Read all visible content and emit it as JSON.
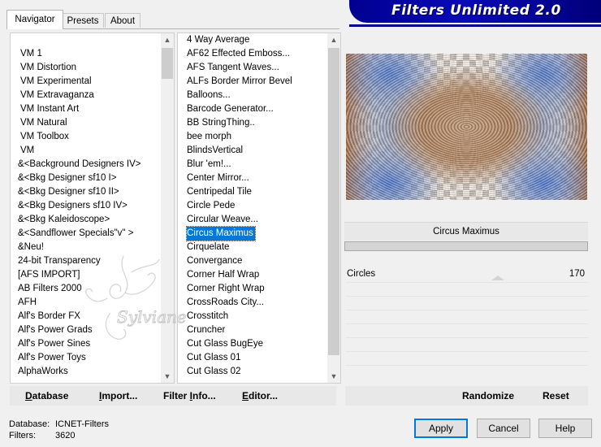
{
  "title": "Filters Unlimited 2.0",
  "tabs": [
    {
      "label": "Navigator",
      "active": true
    },
    {
      "label": "Presets",
      "active": false
    },
    {
      "label": "About",
      "active": false
    }
  ],
  "categories": [
    "VM 1",
    "VM Distortion",
    "VM Experimental",
    "VM Extravaganza",
    "VM Instant Art",
    "VM Natural",
    "VM Toolbox",
    "VM",
    "&<Background Designers IV>",
    "&<Bkg Designer sf10 I>",
    "&<Bkg Designer sf10 II>",
    "&<Bkg Designers sf10 IV>",
    "&<Bkg Kaleidoscope>",
    "&<Sandflower Specials\"v\" >",
    "&Neu!",
    "24-bit Transparency",
    "[AFS IMPORT]",
    "AB Filters 2000",
    "AFH",
    "Alf's Border FX",
    "Alf's Power Grads",
    "Alf's Power Sines",
    "Alf's Power Toys",
    "AlphaWorks"
  ],
  "filters": [
    "4 Way Average",
    "AF62 Effected Emboss...",
    "AFS Tangent Waves...",
    "ALFs Border Mirror Bevel",
    "Balloons...",
    "Barcode Generator...",
    "BB StringThing..",
    "bee morph",
    "BlindsVertical",
    "Blur 'em!...",
    "Center Mirror...",
    "Centripedal Tile",
    "Circle Pede",
    "Circular Weave...",
    "Circus Maximus",
    "Cirquelate",
    "Convergance",
    "Corner Half Wrap",
    "Corner Right Wrap",
    "CrossRoads City...",
    "Crosstitch",
    "Cruncher",
    "Cut Glass  BugEye",
    "Cut Glass 01",
    "Cut Glass 02"
  ],
  "selected_filter": "Circus Maximus",
  "selected_filter_index": 14,
  "parameter": {
    "label": "Circles",
    "value": "170",
    "level": 170,
    "max": 255
  },
  "toolbar": {
    "database": "atabase",
    "database_key": "D",
    "import": "mport...",
    "import_key": "I",
    "filter_info": "Filter ",
    "filter_info_key": "I",
    "filter_info_rest": "nfo...",
    "editor": "ditor...",
    "editor_key": "E",
    "randomize": "Randomize",
    "reset": "Reset"
  },
  "footer": {
    "database_label": "Database:",
    "database_value": "ICNET-Filters",
    "filters_label": "Filters:",
    "filters_value": "3620",
    "apply": "Apply",
    "cancel": "Cancel",
    "help": "Help"
  },
  "watermark_text": "Sylviane",
  "colors": {
    "banner": "#000090",
    "selection": "#0078d7"
  }
}
